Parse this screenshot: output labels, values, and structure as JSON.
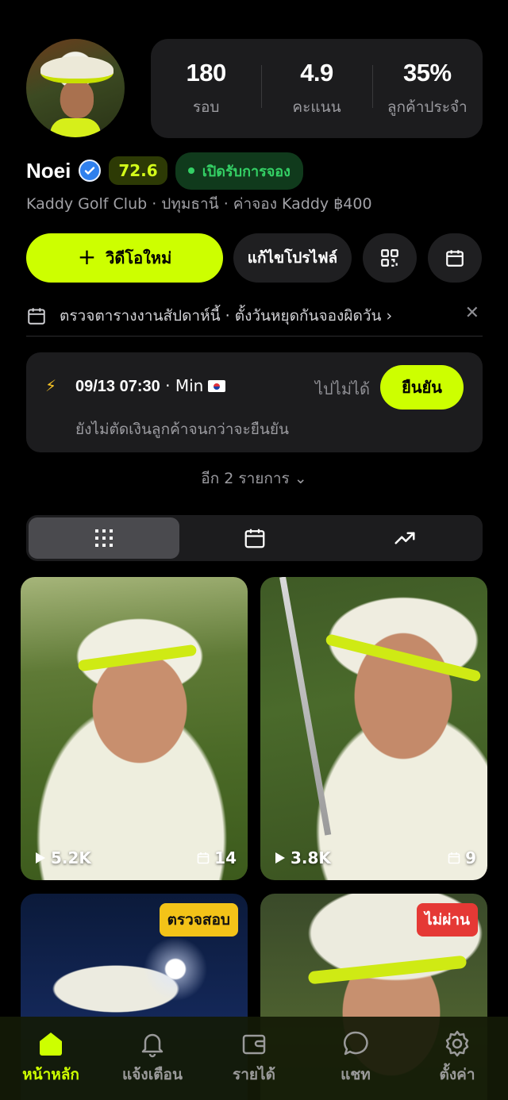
{
  "profile": {
    "name": "Noei",
    "score": "72.6",
    "status": "เปิดรับการจอง",
    "subtitle": "Kaddy Golf Club · ปทุมธานี · ค่าจอง Kaddy ฿400"
  },
  "stats": [
    {
      "value": "180",
      "label": "รอบ"
    },
    {
      "value": "4.9",
      "label": "คะแนน"
    },
    {
      "value": "35%",
      "label": "ลูกค้าประจำ"
    }
  ],
  "actions": {
    "new_video": "วิดีโอใหม่",
    "edit_profile": "แก้ไขโปรไฟล์"
  },
  "notice": {
    "text": "ตรวจตารางงานสัปดาห์นี้ · ตั้งวันหยุดกันจองผิดวัน ›"
  },
  "booking": {
    "datetime": "09/13 07:30",
    "customer": " · Min",
    "decline": "ไปไม่ได้",
    "confirm": "ยืนยัน",
    "note": "ยังไม่ตัดเงินลูกค้าจนกว่าจะยืนยัน"
  },
  "more": "อีก 2 รายการ ⌄",
  "videos": [
    {
      "views": "5.2K",
      "bookings": "14",
      "tag": ""
    },
    {
      "views": "3.8K",
      "bookings": "9",
      "tag": ""
    },
    {
      "views": "",
      "bookings": "",
      "tag": "ตรวจสอบ"
    },
    {
      "views": "",
      "bookings": "",
      "tag": "ไม่ผ่าน"
    }
  ],
  "nav": [
    {
      "label": "หน้าหลัก",
      "icon": "home-icon",
      "active": true
    },
    {
      "label": "แจ้งเตือน",
      "icon": "bell-icon",
      "active": false
    },
    {
      "label": "รายได้",
      "icon": "wallet-icon",
      "active": false
    },
    {
      "label": "แชท",
      "icon": "chat-icon",
      "active": false
    },
    {
      "label": "ตั้งค่า",
      "icon": "gear-icon",
      "active": false
    }
  ],
  "colors": {
    "accent": "#cdff00",
    "background": "#000000",
    "card": "#1c1c1e",
    "open_status": "#34d065",
    "review_tag": "#f3c318",
    "fail_tag": "#e53935"
  }
}
